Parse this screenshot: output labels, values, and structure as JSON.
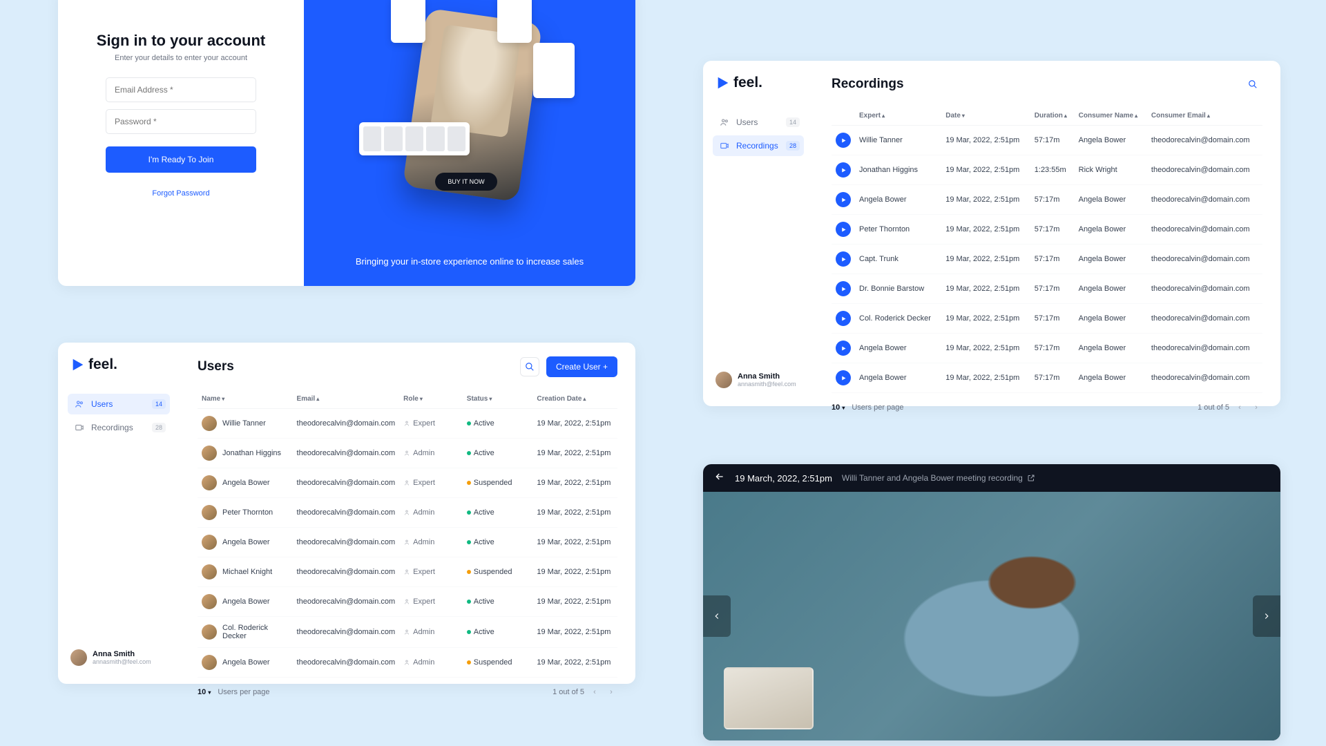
{
  "signin": {
    "title": "Sign in to your account",
    "subtitle": "Enter your details to enter your account",
    "email_placeholder": "Email Address *",
    "password_placeholder": "Password *",
    "button": "I'm Ready To Join",
    "forgot": "Forgot Password",
    "tagline": "Bringing your in-store experience online to increase sales",
    "buy_now": "BUY IT NOW"
  },
  "brand": {
    "name": "feel."
  },
  "sidebar": {
    "items": [
      {
        "label": "Users",
        "badge": "14"
      },
      {
        "label": "Recordings",
        "badge": "28"
      }
    ]
  },
  "current_user": {
    "name": "Anna Smith",
    "email": "annasmith@feel.com"
  },
  "users_panel": {
    "title": "Users",
    "create_btn": "Create User +",
    "columns": [
      "Name",
      "Email",
      "Role",
      "Status",
      "Creation Date"
    ],
    "rows": [
      {
        "name": "Willie Tanner",
        "email": "theodorecalvin@domain.com",
        "role": "Expert",
        "status": "Active",
        "date": "19 Mar, 2022, 2:51pm"
      },
      {
        "name": "Jonathan Higgins",
        "email": "theodorecalvin@domain.com",
        "role": "Admin",
        "status": "Active",
        "date": "19 Mar, 2022, 2:51pm"
      },
      {
        "name": "Angela Bower",
        "email": "theodorecalvin@domain.com",
        "role": "Expert",
        "status": "Suspended",
        "date": "19 Mar, 2022, 2:51pm"
      },
      {
        "name": "Peter Thornton",
        "email": "theodorecalvin@domain.com",
        "role": "Admin",
        "status": "Active",
        "date": "19 Mar, 2022, 2:51pm"
      },
      {
        "name": "Angela Bower",
        "email": "theodorecalvin@domain.com",
        "role": "Admin",
        "status": "Active",
        "date": "19 Mar, 2022, 2:51pm"
      },
      {
        "name": "Michael Knight",
        "email": "theodorecalvin@domain.com",
        "role": "Expert",
        "status": "Suspended",
        "date": "19 Mar, 2022, 2:51pm"
      },
      {
        "name": "Angela Bower",
        "email": "theodorecalvin@domain.com",
        "role": "Expert",
        "status": "Active",
        "date": "19 Mar, 2022, 2:51pm"
      },
      {
        "name": "Col. Roderick Decker",
        "email": "theodorecalvin@domain.com",
        "role": "Admin",
        "status": "Active",
        "date": "19 Mar, 2022, 2:51pm"
      },
      {
        "name": "Angela Bower",
        "email": "theodorecalvin@domain.com",
        "role": "Admin",
        "status": "Suspended",
        "date": "19 Mar, 2022, 2:51pm"
      }
    ],
    "per_page_value": "10",
    "per_page_label": "Users per page",
    "page_info": "1 out of 5"
  },
  "recordings_panel": {
    "title": "Recordings",
    "columns": [
      "Expert",
      "Date",
      "Duration",
      "Consumer Name",
      "Consumer Email"
    ],
    "rows": [
      {
        "expert": "Willie Tanner",
        "date": "19 Mar, 2022, 2:51pm",
        "duration": "57:17m",
        "consumer": "Angela Bower",
        "email": "theodorecalvin@domain.com"
      },
      {
        "expert": "Jonathan Higgins",
        "date": "19 Mar, 2022, 2:51pm",
        "duration": "1:23:55m",
        "consumer": "Rick Wright",
        "email": "theodorecalvin@domain.com"
      },
      {
        "expert": "Angela Bower",
        "date": "19 Mar, 2022, 2:51pm",
        "duration": "57:17m",
        "consumer": "Angela Bower",
        "email": "theodorecalvin@domain.com"
      },
      {
        "expert": "Peter Thornton",
        "date": "19 Mar, 2022, 2:51pm",
        "duration": "57:17m",
        "consumer": "Angela Bower",
        "email": "theodorecalvin@domain.com"
      },
      {
        "expert": "Capt. Trunk",
        "date": "19 Mar, 2022, 2:51pm",
        "duration": "57:17m",
        "consumer": "Angela Bower",
        "email": "theodorecalvin@domain.com"
      },
      {
        "expert": "Dr. Bonnie Barstow",
        "date": "19 Mar, 2022, 2:51pm",
        "duration": "57:17m",
        "consumer": "Angela Bower",
        "email": "theodorecalvin@domain.com"
      },
      {
        "expert": "Col. Roderick Decker",
        "date": "19 Mar, 2022, 2:51pm",
        "duration": "57:17m",
        "consumer": "Angela Bower",
        "email": "theodorecalvin@domain.com"
      },
      {
        "expert": "Angela Bower",
        "date": "19 Mar, 2022, 2:51pm",
        "duration": "57:17m",
        "consumer": "Angela Bower",
        "email": "theodorecalvin@domain.com"
      },
      {
        "expert": "Angela Bower",
        "date": "19 Mar, 2022, 2:51pm",
        "duration": "57:17m",
        "consumer": "Angela Bower",
        "email": "theodorecalvin@domain.com"
      }
    ],
    "per_page_value": "10",
    "per_page_label": "Users per page",
    "page_info": "1 out of 5"
  },
  "player": {
    "date": "19 March, 2022, 2:51pm",
    "title": "Willi Tanner and Angela Bower meeting recording"
  }
}
